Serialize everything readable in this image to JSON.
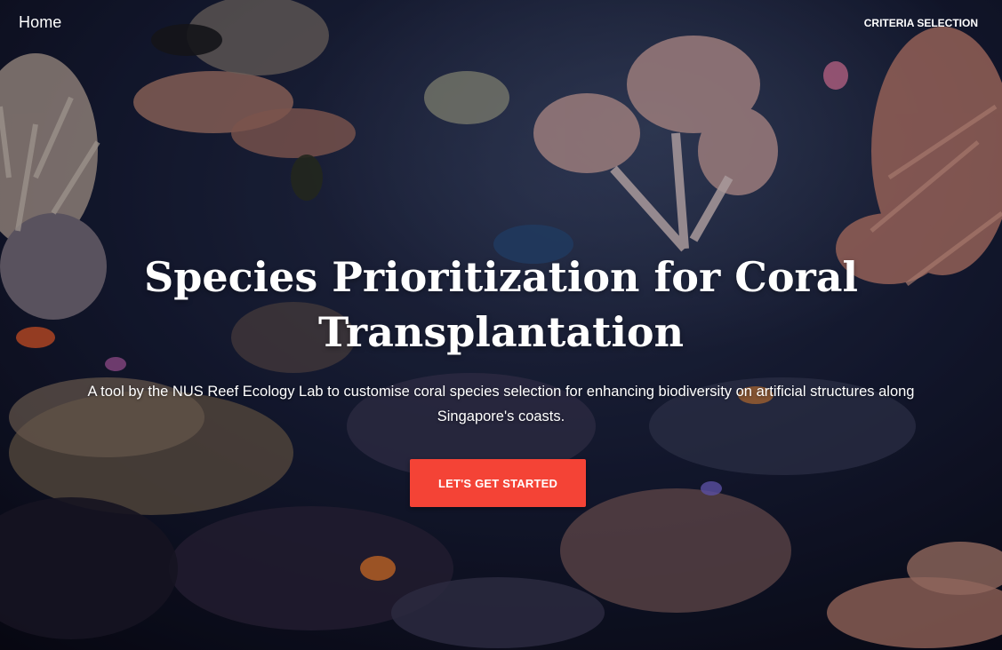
{
  "nav": {
    "home_label": "Home",
    "criteria_label": "CRITERIA SELECTION"
  },
  "hero": {
    "title": "Species Prioritization for Coral Transplantation",
    "subtitle": "A tool by the NUS Reef Ecology Lab to customise coral species selection for enhancing biodiversity on artificial structures along Singapore's coasts.",
    "cta_label": "LET'S GET STARTED"
  },
  "colors": {
    "accent": "#f44336",
    "text": "#ffffff",
    "background": "#0a0c18"
  }
}
